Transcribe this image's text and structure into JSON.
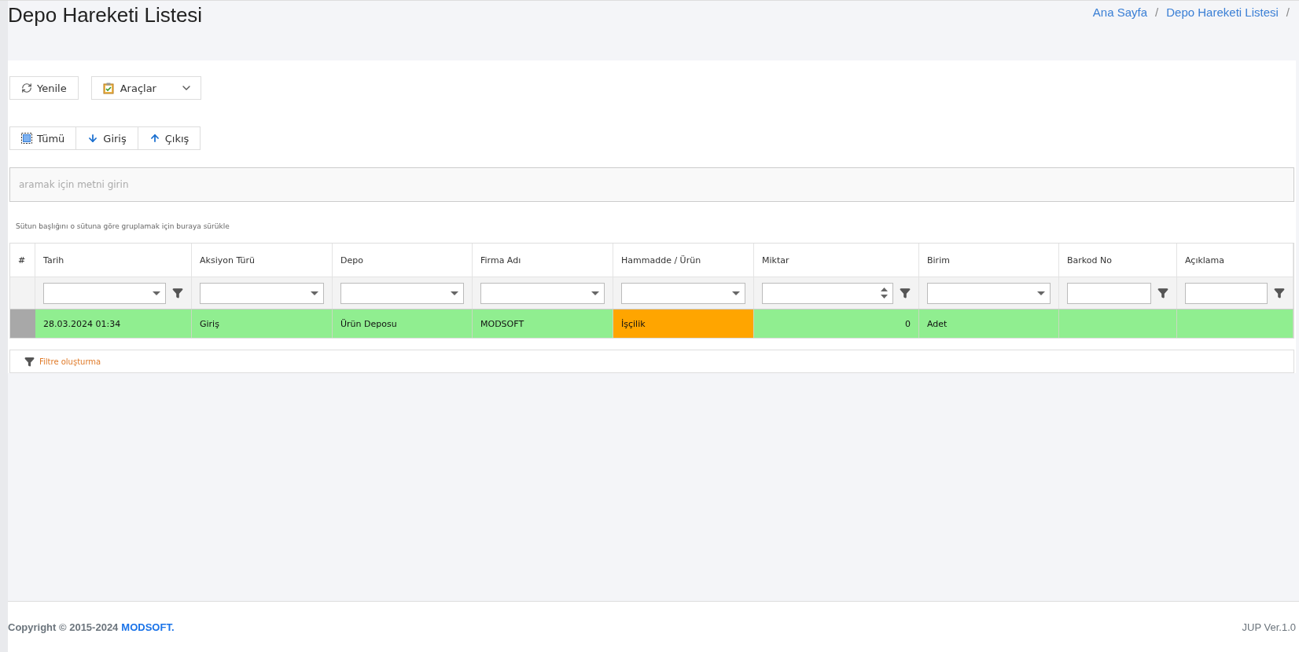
{
  "page_title": "Depo Hareketi Listesi",
  "breadcrumb": {
    "separator": "/",
    "items": [
      "Ana Sayfa",
      "Depo Hareketi Listesi"
    ]
  },
  "toolbar": [
    {
      "kind": "refresh",
      "label": "Yenile"
    },
    {
      "kind": "menu",
      "label": "Araçlar"
    }
  ],
  "filter_tabs": [
    {
      "kind": "all",
      "label": "Tümü"
    },
    {
      "kind": "in",
      "label": "Giriş"
    },
    {
      "kind": "out",
      "label": "Çıkış"
    }
  ],
  "search": {
    "placeholder": "aramak için metni girin"
  },
  "group_panel": "Sütun başlığını o sütuna göre gruplamak için buraya sürükle",
  "table": {
    "index_header": "#",
    "columns": [
      {
        "label": "Tarih",
        "filter": {
          "kind": "dropdown",
          "button": true
        }
      },
      {
        "label": "Aksiyon Türü",
        "filter": {
          "kind": "dropdown",
          "button": false
        }
      },
      {
        "label": "Depo",
        "filter": {
          "kind": "dropdown",
          "button": false
        }
      },
      {
        "label": "Firma Adı",
        "filter": {
          "kind": "dropdown",
          "button": false
        }
      },
      {
        "label": "Hammadde / Ürün",
        "filter": {
          "kind": "dropdown",
          "button": false
        }
      },
      {
        "label": "Miktar",
        "filter": {
          "kind": "number",
          "button": true
        }
      },
      {
        "label": "Birim",
        "filter": {
          "kind": "dropdown",
          "button": false
        }
      },
      {
        "label": "Barkod No",
        "filter": {
          "kind": "text",
          "button": true
        }
      },
      {
        "label": "Açıklama",
        "filter": {
          "kind": "text",
          "button": true
        }
      }
    ],
    "rows": [
      {
        "cells": [
          {
            "text": "28.03.2024 01:34",
            "color": "#90ee90"
          },
          {
            "text": "Giriş",
            "color": "#90ee90"
          },
          {
            "text": "Ürün Deposu",
            "color": "#90ee90"
          },
          {
            "text": "MODSOFT",
            "color": "#90ee90"
          },
          {
            "text": "İşçilik",
            "color": "#ffa500"
          },
          {
            "text": "0",
            "color": "#90ee90",
            "kind": "number"
          },
          {
            "text": "Adet",
            "color": "#90ee90"
          },
          {
            "color": "#90ee90"
          },
          {
            "color": "#90ee90"
          }
        ]
      }
    ]
  },
  "filter_builder": "Filtre oluşturma",
  "footer": {
    "copyright": "Copyright © 2015-2024",
    "brand": "MODSOFT.",
    "version": "JUP Ver.1.0"
  }
}
